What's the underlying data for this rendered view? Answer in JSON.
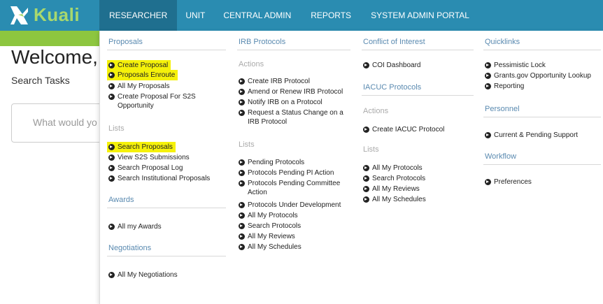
{
  "app": {
    "logo_text": "Kuali"
  },
  "nav": [
    "RESEARCHER",
    "UNIT",
    "CENTRAL ADMIN",
    "REPORTS",
    "SYSTEM ADMIN PORTAL"
  ],
  "background": {
    "welcome": "Welcome,",
    "search_tasks": "Search Tasks",
    "search_placeholder": "What would yo"
  },
  "menu": {
    "proposals": {
      "title": "Proposals",
      "items": [
        "Create Proposal",
        "Proposals Enroute",
        "All My Proposals",
        "Create Proposal For S2S Opportunity"
      ],
      "lists_label": "Lists",
      "lists": [
        "Search Proposals",
        "View S2S Submissions",
        "Search Proposal Log",
        "Search Institutional Proposals"
      ]
    },
    "awards": {
      "title": "Awards",
      "items": [
        "All my Awards"
      ]
    },
    "negotiations": {
      "title": "Negotiations",
      "items": [
        "All My Negotiations"
      ]
    },
    "irb": {
      "title": "IRB Protocols",
      "actions_label": "Actions",
      "actions": [
        "Create IRB Protocol",
        "Amend or Renew IRB Protocol",
        "Notify IRB on a Protocol",
        "Request a Status Change on a IRB Protocol"
      ],
      "lists_label": "Lists",
      "lists": [
        "Pending Protocols",
        "Protocols Pending PI Action",
        "Protocols Pending Committee Action",
        "Protocols Under Development",
        "All My Protocols",
        "Search Protocols",
        "All My Reviews",
        "All My Schedules"
      ]
    },
    "coi": {
      "title": "Conflict of Interest",
      "items": [
        "COI Dashboard"
      ]
    },
    "iacuc": {
      "title": "IACUC Protocols",
      "actions_label": "Actions",
      "actions": [
        "Create IACUC Protocol"
      ],
      "lists_label": "Lists",
      "lists": [
        "All My Protocols",
        "Search Protocols",
        "All My Reviews",
        "All My Schedules"
      ]
    },
    "quicklinks": {
      "title": "Quicklinks",
      "items": [
        "Pessimistic Lock",
        "Grants.gov Opportunity Lookup",
        "Reporting"
      ]
    },
    "personnel": {
      "title": "Personnel",
      "items": [
        "Current & Pending Support"
      ]
    },
    "workflow": {
      "title": "Workflow",
      "items": [
        "Preferences"
      ]
    }
  },
  "colors": {
    "topbar": "#2a8cb1",
    "active_nav": "#1f6f8f",
    "accent_green": "#8dc63f",
    "highlight": "#f5f10a",
    "section_title": "#5a8ab0"
  }
}
